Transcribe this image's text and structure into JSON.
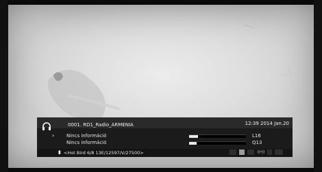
{
  "channel": {
    "number_name": "0001.  RD1_Radio_ARMENIA",
    "datetime": "12:39 2014 Jan.20"
  },
  "info": {
    "line1": "Nincs információ",
    "line2": "Nincs információ",
    "level1": "L16",
    "level2": "Q13",
    "signal_level_fraction": 0.16,
    "signal_quality_fraction": 0.13
  },
  "transponder": {
    "text": "<Hot Bird 6/8 13E/12597/V/27500>"
  },
  "icons": {
    "audio": "headphones-icon",
    "satellite": "satellite-icon",
    "status": [
      "radio-icon",
      "favorite-icon",
      "subtitle-icon",
      "signal-icon",
      "lock-icon",
      "hd-icon"
    ]
  },
  "colors": {
    "banner": "#1b1b1b",
    "bar_fill": "#eaeaea",
    "background": "#dedede"
  }
}
